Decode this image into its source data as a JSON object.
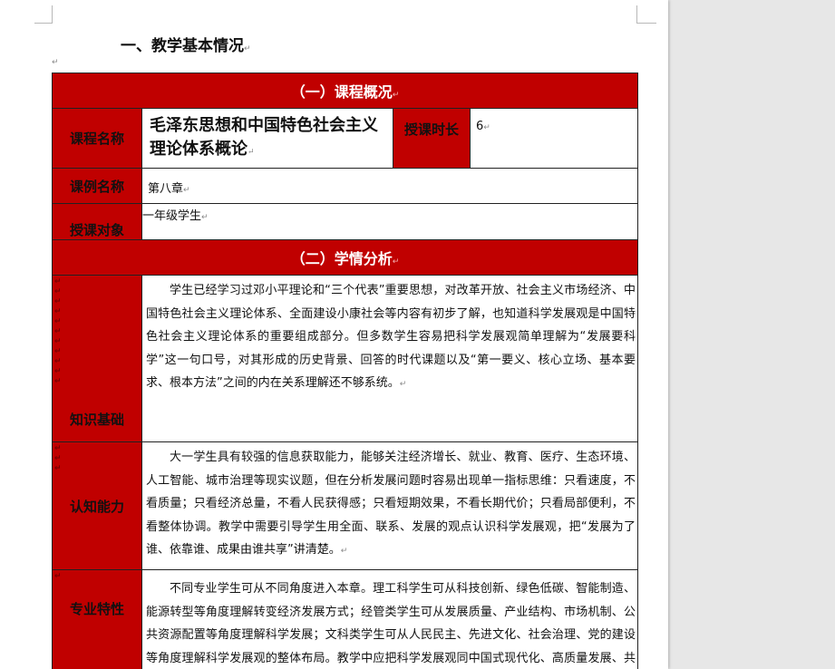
{
  "heading": "一、教学基本情况",
  "table": {
    "section1_title": "（一）课程概况",
    "course_name_label": "课程名称",
    "course_name_value": "毛泽东思想和中国特色社会主义理论体系概论",
    "duration_label": "授课时长",
    "duration_value": "6",
    "case_name_label": "课例名称",
    "case_name_value": "第八章",
    "audience_label": "授课对象",
    "audience_value": "一年级学生",
    "section2_title": "（二）学情分析",
    "knowledge_label": "知识基础",
    "knowledge_text": "学生已经学习过邓小平理论和“三个代表”重要思想，对改革开放、社会主义市场经济、中国特色社会主义理论体系、全面建设小康社会等内容有初步了解，也知道科学发展观是中国特色社会主义理论体系的重要组成部分。但多数学生容易把科学发展观简单理解为“发展要科学”这一句口号，对其形成的历史背景、回答的时代课题以及“第一要义、核心立场、基本要求、根本方法”之间的内在关系理解还不够系统。",
    "cognitive_label": "认知能力",
    "cognitive_text": "大一学生具有较强的信息获取能力，能够关注经济增长、就业、教育、医疗、生态环境、人工智能、城市治理等现实议题，但在分析发展问题时容易出现单一指标思维：只看速度，不看质量；只看经济总量，不看人民获得感；只看短期效果，不看长期代价；只看局部便利，不看整体协调。教学中需要引导学生用全面、联系、发展的观点认识科学发展观，把“发展为了谁、依靠谁、成果由谁共享”讲清楚。",
    "major_label": "专业特性",
    "major_text": "不同专业学生可从不同角度进入本章。理工科学生可从科技创新、绿色低碳、智能制造、能源转型等角度理解转变经济发展方式；经管类学生可从发展质量、产业结构、市场机制、公共资源配置等角度理解科学发展；文科类学生可从人民民主、先进文化、社会治理、党的建设等角度理解科学发展观的整体布局。教学中应把科学发展观同中国式现代化、高质量发展、共同富裕、美丽中国建设、全过程人民民主等理论"
  },
  "colors": {
    "header_red": "#c00000",
    "border": "#222222"
  }
}
